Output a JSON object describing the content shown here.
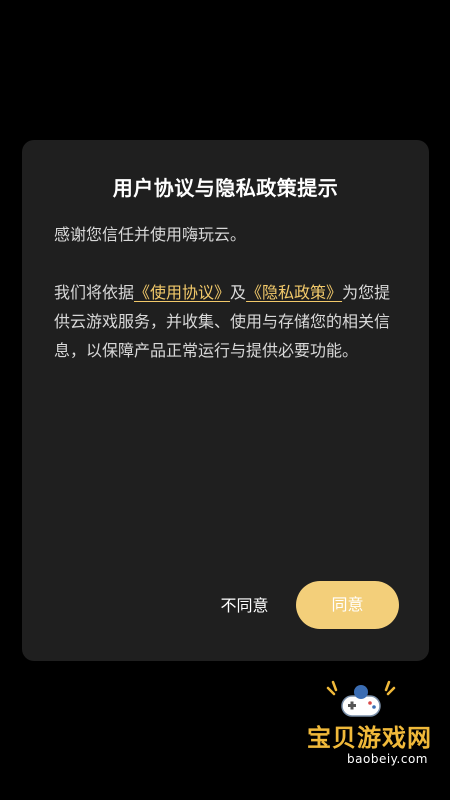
{
  "dialog": {
    "title": "用户协议与隐私政策提示",
    "intro": "感谢您信任并使用嗨玩云。",
    "body_prefix": "我们将依据",
    "link_terms": "《使用协议》",
    "conjunction": "及",
    "link_privacy": "《隐私政策》",
    "body_suffix": "为您提供云游戏服务，并收集、使用与存储您的相关信息，以保障产品正常运行与提供必要功能。",
    "disagree_label": "不同意",
    "agree_label": "同意"
  },
  "watermark": {
    "name": "宝贝游戏网",
    "url": "baobeiy.com",
    "logo_icon": "gamepad-logo-icon"
  },
  "colors": {
    "background": "#000000",
    "dialog": "#1f1f1f",
    "link": "#f2c96a",
    "agree_button": "#f3cf7a"
  }
}
